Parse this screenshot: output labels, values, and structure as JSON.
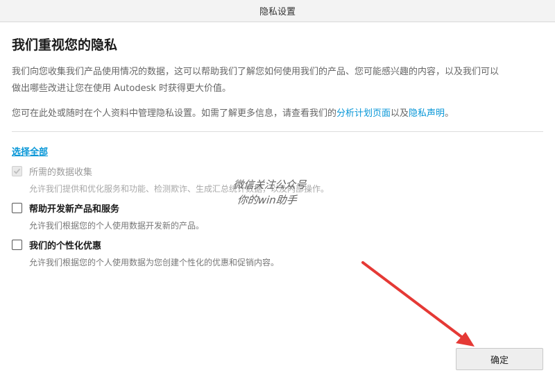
{
  "window": {
    "title": "隐私设置"
  },
  "heading": "我们重视您的隐私",
  "intro": {
    "line1": "我们向您收集我们产品使用情况的数据，这可以帮助我们了解您如何使用我们的产品、您可能感兴趣的内容，以及我们可以",
    "line2": "做出哪些改进让您在使用 Autodesk 时获得更大价值。"
  },
  "manage": {
    "prefix": "您可在此处或随时在个人资料中管理隐私设置。如需了解更多信息，请查看我们的",
    "link1": "分析计划页面",
    "between": "以及",
    "link2": "隐私声明",
    "suffix": "。"
  },
  "select_all": "选择全部",
  "options": [
    {
      "label": "所需的数据收集",
      "desc": "允许我们提供和优化服务和功能、检测欺诈、生成汇总统计数据，以及内部操作。",
      "checked": true,
      "disabled": true
    },
    {
      "label": "帮助开发新产品和服务",
      "desc": "允许我们根据您的个人使用数据开发新的产品。",
      "checked": false,
      "disabled": false
    },
    {
      "label": "我们的个性化优惠",
      "desc": "允许我们根据您的个人使用数据为您创建个性化的优惠和促销内容。",
      "checked": false,
      "disabled": false
    }
  ],
  "watermark": {
    "line1": "微信关注公众号",
    "line2": "你的win助手"
  },
  "ok_button": "确定",
  "colors": {
    "link": "#0696d7",
    "arrow": "#e53935"
  }
}
